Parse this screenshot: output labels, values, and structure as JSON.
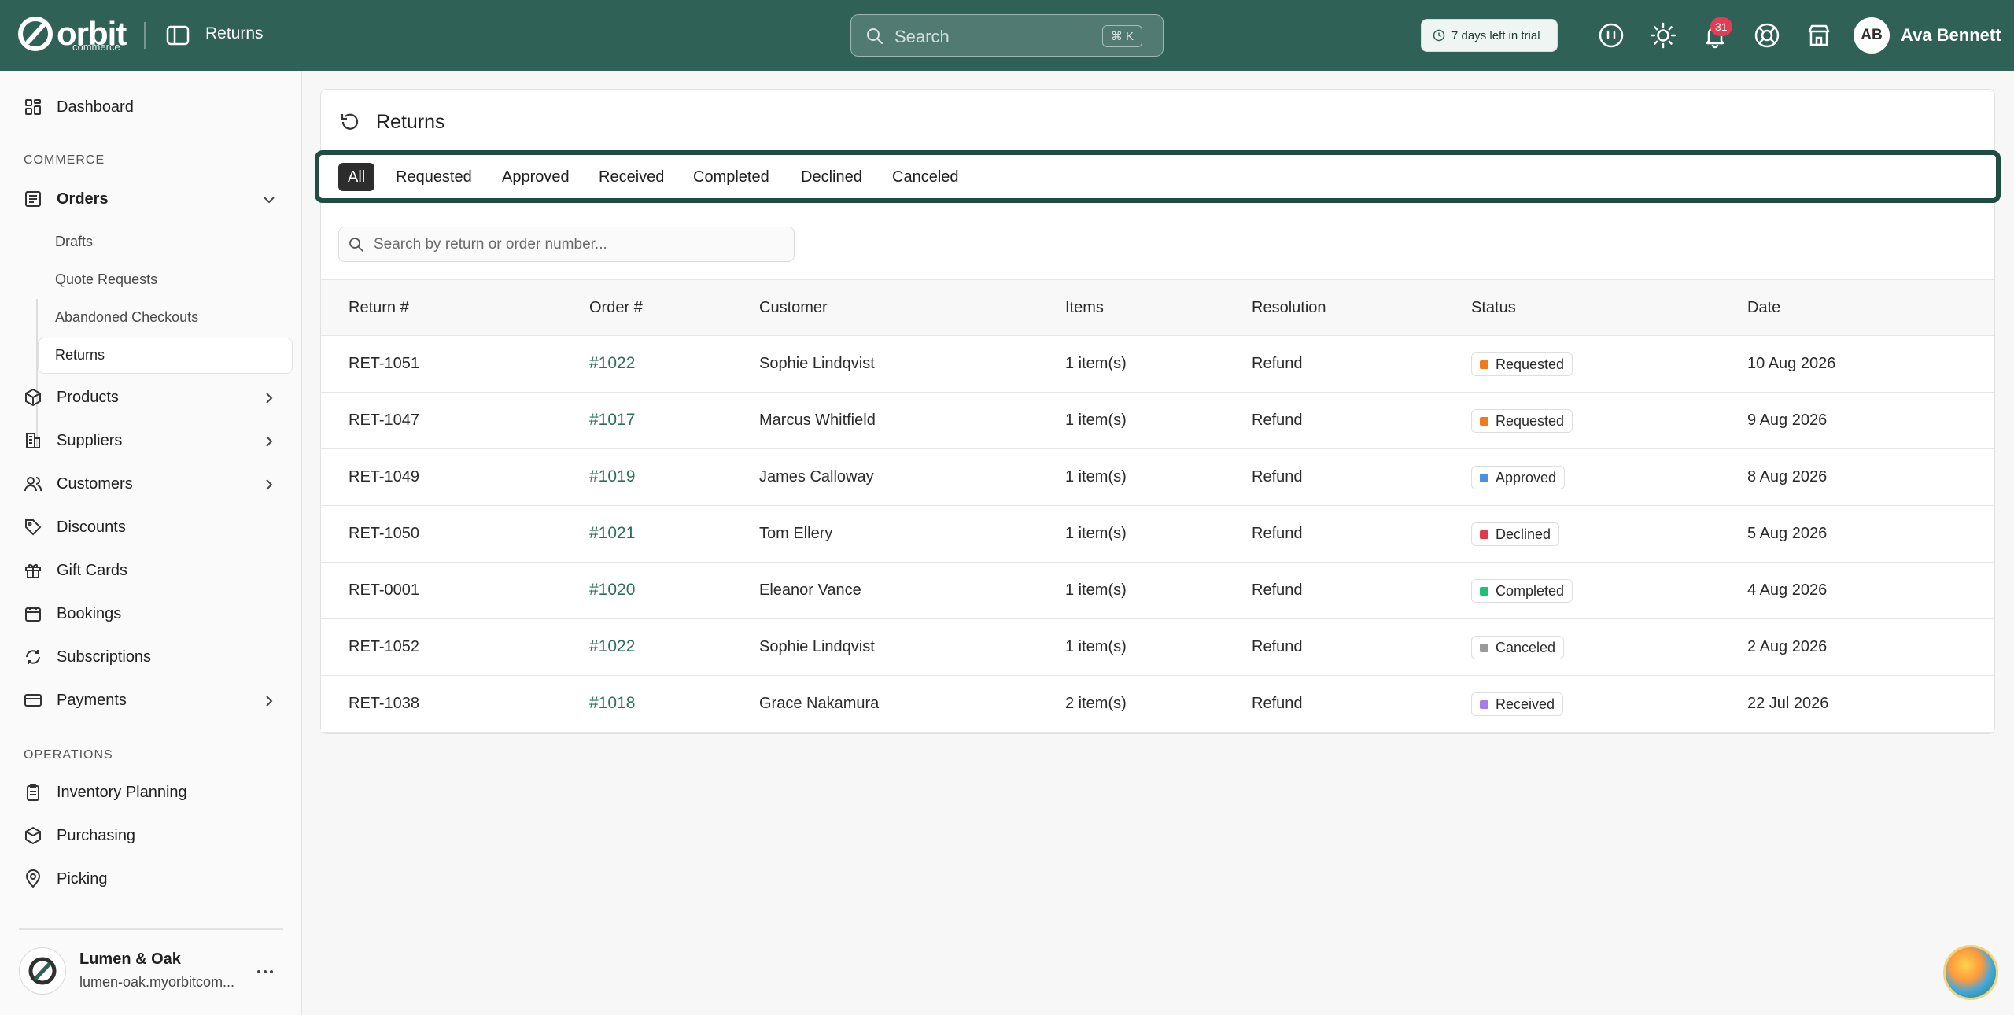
{
  "topbar": {
    "logo_word": "orbit",
    "logo_sub": "commerce",
    "page_title": "Returns",
    "search_placeholder": "Search",
    "search_shortcut": "⌘ K",
    "trial_text": "7 days left in trial",
    "notification_count": "31",
    "user_initials": "AB",
    "user_name": "Ava Bennett"
  },
  "sidebar": {
    "dashboard": "Dashboard",
    "section_commerce": "COMMERCE",
    "orders": "Orders",
    "orders_sub": [
      "Drafts",
      "Quote Requests",
      "Abandoned Checkouts",
      "Returns"
    ],
    "products": "Products",
    "suppliers": "Suppliers",
    "customers": "Customers",
    "discounts": "Discounts",
    "gift_cards": "Gift Cards",
    "bookings": "Bookings",
    "subscriptions": "Subscriptions",
    "payments": "Payments",
    "section_operations": "OPERATIONS",
    "inventory_planning": "Inventory Planning",
    "purchasing": "Purchasing",
    "picking": "Picking",
    "store_name": "Lumen & Oak",
    "store_url": "lumen-oak.myorbitcom..."
  },
  "main": {
    "title": "Returns",
    "tabs": [
      "All",
      "Requested",
      "Approved",
      "Received",
      "Completed",
      "Declined",
      "Canceled"
    ],
    "active_tab": "All",
    "search_placeholder": "Search by return or order number...",
    "columns": [
      "Return #",
      "Order #",
      "Customer",
      "Items",
      "Resolution",
      "Status",
      "Date"
    ],
    "rows": [
      {
        "return": "RET-1051",
        "order": "#1022",
        "customer": "Sophie Lindqvist",
        "items": "1 item(s)",
        "resolution": "Refund",
        "status": "Requested",
        "date": "10 Aug 2026"
      },
      {
        "return": "RET-1047",
        "order": "#1017",
        "customer": "Marcus Whitfield",
        "items": "1 item(s)",
        "resolution": "Refund",
        "status": "Requested",
        "date": "9 Aug 2026"
      },
      {
        "return": "RET-1049",
        "order": "#1019",
        "customer": "James Calloway",
        "items": "1 item(s)",
        "resolution": "Refund",
        "status": "Approved",
        "date": "8 Aug 2026"
      },
      {
        "return": "RET-1050",
        "order": "#1021",
        "customer": "Tom Ellery",
        "items": "1 item(s)",
        "resolution": "Refund",
        "status": "Declined",
        "date": "5 Aug 2026"
      },
      {
        "return": "RET-0001",
        "order": "#1020",
        "customer": "Eleanor Vance",
        "items": "1 item(s)",
        "resolution": "Refund",
        "status": "Completed",
        "date": "4 Aug 2026"
      },
      {
        "return": "RET-1052",
        "order": "#1022",
        "customer": "Sophie Lindqvist",
        "items": "1 item(s)",
        "resolution": "Refund",
        "status": "Canceled",
        "date": "2 Aug 2026"
      },
      {
        "return": "RET-1038",
        "order": "#1018",
        "customer": "Grace Nakamura",
        "items": "2 item(s)",
        "resolution": "Refund",
        "status": "Received",
        "date": "22 Jul 2026"
      }
    ]
  },
  "colors": {
    "brand": "#2f6157",
    "tab_frame": "#1f4d41",
    "link": "#2b6e5c",
    "status": {
      "Requested": "#f07a1a",
      "Approved": "#4a90e2",
      "Declined": "#e0394c",
      "Completed": "#1fbf7a",
      "Canceled": "#9a9a9a",
      "Received": "#a77be8"
    }
  }
}
